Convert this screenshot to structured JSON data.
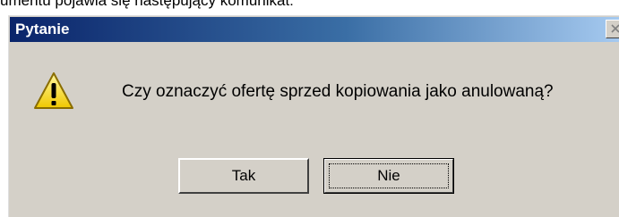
{
  "document": {
    "text_above": "umentu pojawia się następujący komunikat:"
  },
  "dialog": {
    "title": "Pytanie",
    "icon": "warning-icon",
    "message": "Czy oznaczyć ofertę sprzed kopiowania jako anulowaną?",
    "buttons": {
      "yes_label": "Tak",
      "no_label": "Nie"
    },
    "colors": {
      "titlebar_start": "#0a246a",
      "titlebar_end": "#a6caf0",
      "face": "#d4d0c8"
    }
  }
}
